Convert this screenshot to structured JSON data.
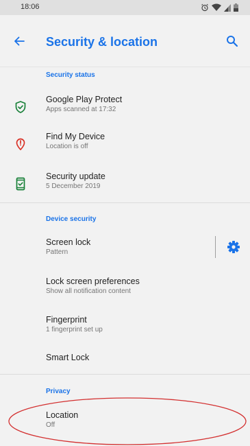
{
  "status_bar": {
    "time": "18:06"
  },
  "app_bar": {
    "title": "Security & location"
  },
  "sections": {
    "security_status": "Security status",
    "device_security": "Device security",
    "privacy": "Privacy"
  },
  "security_items": [
    {
      "title": "Google Play Protect",
      "subtitle": "Apps scanned at 17:32",
      "icon": "shield-check-icon",
      "color": "#188038"
    },
    {
      "title": "Find My Device",
      "subtitle": "Location is off",
      "icon": "location-alert-icon",
      "color": "#d93025"
    },
    {
      "title": "Security update",
      "subtitle": "5 December 2019",
      "icon": "phone-check-icon",
      "color": "#188038"
    }
  ],
  "device_items": [
    {
      "title": "Screen lock",
      "subtitle": "Pattern"
    },
    {
      "title": "Lock screen preferences",
      "subtitle": "Show all notification content"
    },
    {
      "title": "Fingerprint",
      "subtitle": "1 fingerprint set up"
    },
    {
      "title": "Smart Lock",
      "subtitle": ""
    }
  ],
  "privacy_items": [
    {
      "title": "Location",
      "subtitle": "Off"
    }
  ],
  "colors": {
    "accent": "#1a73e8",
    "background": "#f2f2f2",
    "annotation": "#d32f2f"
  }
}
